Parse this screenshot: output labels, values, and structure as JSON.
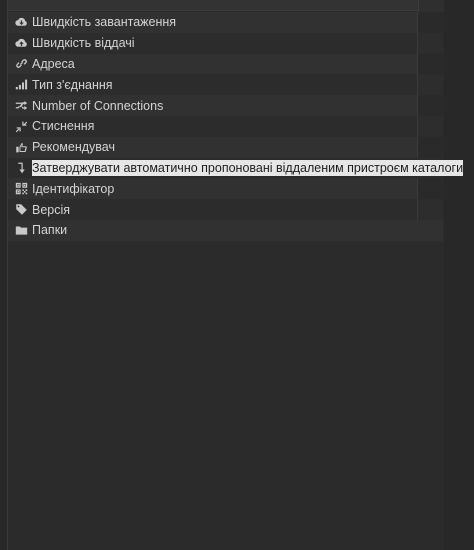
{
  "rows": [
    {
      "icon": "cloud-download-icon",
      "label": "Швидкість завантаження"
    },
    {
      "icon": "cloud-upload-icon",
      "label": "Швидкість віддачі"
    },
    {
      "icon": "link-icon",
      "label": "Адреса"
    },
    {
      "icon": "signal-bars-icon",
      "label": "Тип з'єднання"
    },
    {
      "icon": "shuffle-icon",
      "label": "Number of Connections"
    },
    {
      "icon": "compress-icon",
      "label": "Стиснення"
    },
    {
      "icon": "thumbs-up-icon",
      "label": "Рекомендувач"
    },
    {
      "icon": "level-down-icon",
      "label": "Затверджувати автоматично пропоновані віддаленим пристроєм каталоги"
    },
    {
      "icon": "qrcode-icon",
      "label": "Ідентифікатор"
    },
    {
      "icon": "tag-icon",
      "label": "Версія"
    },
    {
      "icon": "folder-icon",
      "label": "Папки"
    }
  ],
  "selected_row": 7
}
